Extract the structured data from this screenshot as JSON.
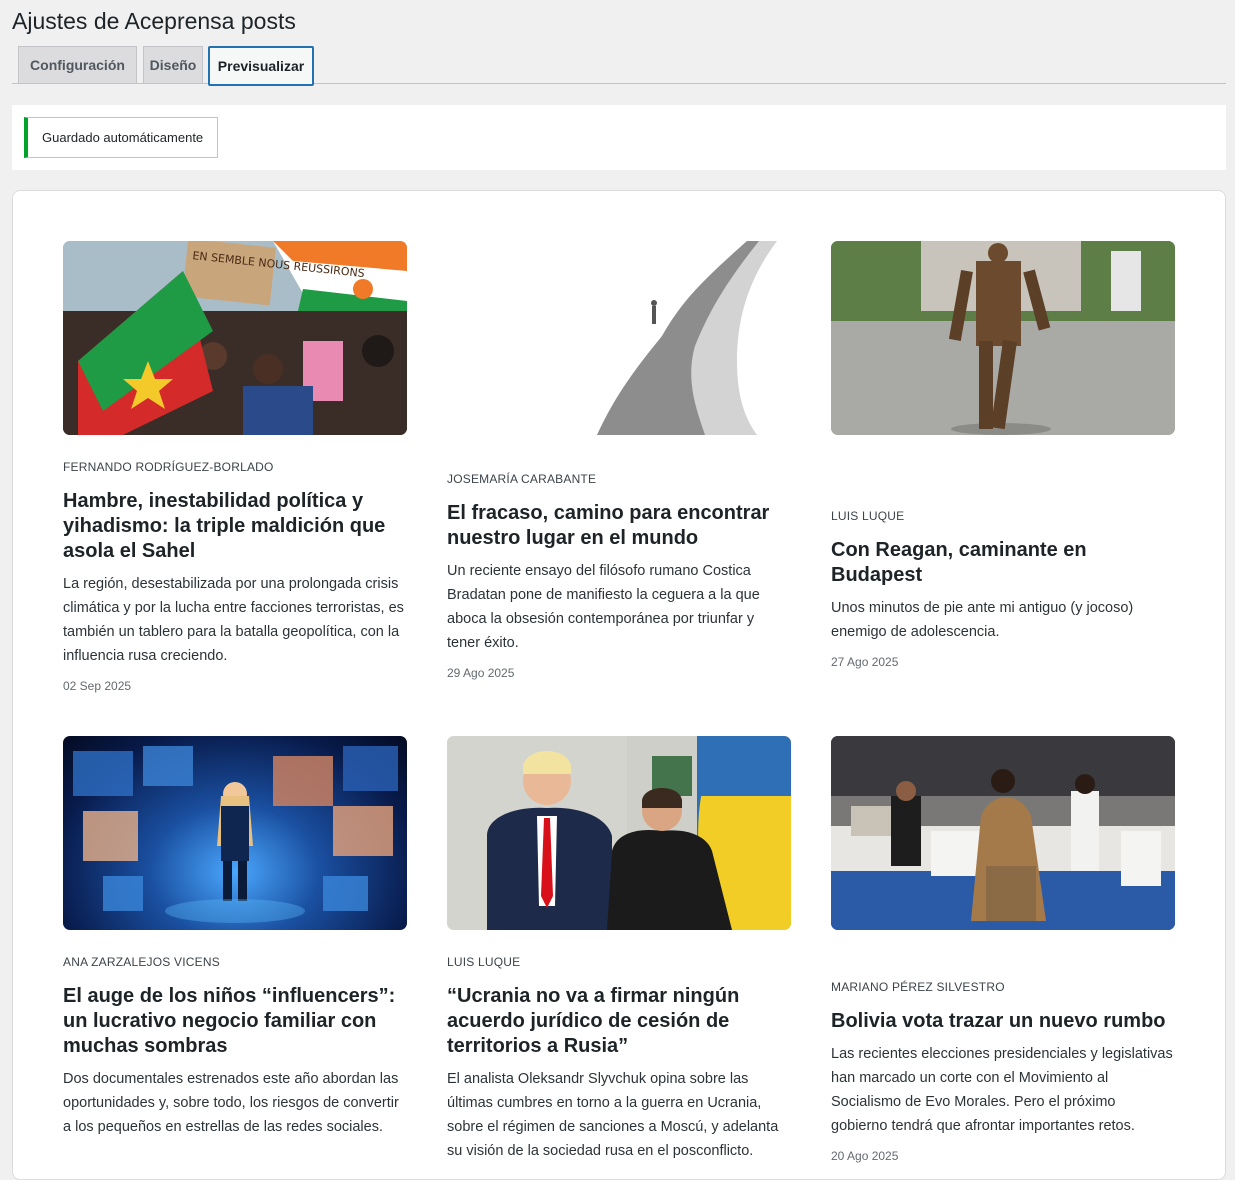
{
  "page": {
    "title": "Ajustes de Aceprensa posts"
  },
  "tabs": [
    {
      "label": "Configuración"
    },
    {
      "label": "Diseño"
    },
    {
      "label": "Previsualizar"
    }
  ],
  "notice": {
    "text": "Guardado automáticamente"
  },
  "colors": {
    "accent": "#2271b1",
    "success": "#00a32a"
  },
  "posts": [
    {
      "author": "FERNANDO RODRÍGUEZ-BORLADO",
      "title": "Hambre, inestabilidad política y yihadismo: la triple maldición que asola el Sahel",
      "excerpt": "La región, desestabilizada por una prolongada crisis climática y por la lucha entre facciones terroristas, es también un tablero para la batalla geopolítica, con la influencia rusa creciendo.",
      "date": "02 Sep 2025",
      "image_sign_text": "EN SEMBLE NOUS REUSSIRONS"
    },
    {
      "author": "JOSEMARÍA CARABANTE",
      "title": "El fracaso, camino para encontrar nuestro lugar en el mundo",
      "excerpt": "Un reciente ensayo del filósofo rumano Costica Bradatan pone de manifiesto la ceguera a la que aboca la obsesión contemporánea por triunfar y tener éxito.",
      "date": "29 Ago 2025"
    },
    {
      "author": "LUIS LUQUE",
      "title": "Con Reagan, caminante en Budapest",
      "excerpt": "Unos minutos de pie ante mi antiguo (y jocoso) enemigo de adolescencia.",
      "date": "27 Ago 2025"
    },
    {
      "author": "ANA ZARZALEJOS VICENS",
      "title": "El auge de los niños “influencers”: un lucrativo negocio familiar con muchas sombras",
      "excerpt": "Dos documentales estrenados este año abordan las oportunidades y, sobre todo, los riesgos de convertir a los pequeños en estrellas de las redes sociales.",
      "date": ""
    },
    {
      "author": "LUIS LUQUE",
      "title": "“Ucrania no va a firmar ningún acuerdo jurídico de cesión de territorios a Rusia”",
      "excerpt": "El analista Oleksandr Slyvchuk opina sobre las últimas cumbres en torno a la guerra en Ucrania, sobre el régimen de sanciones a Moscú, y adelanta su visión de la sociedad rusa en el posconflicto.",
      "date": ""
    },
    {
      "author": "MARIANO PÉREZ SILVESTRO",
      "title": "Bolivia vota trazar un nuevo rumbo",
      "excerpt": "Las recientes elecciones presidenciales y legislativas han marcado un corte con el Movimiento al Socialismo de Evo Morales. Pero el próximo gobierno tendrá que afrontar importantes retos.",
      "date": "20 Ago 2025"
    }
  ]
}
